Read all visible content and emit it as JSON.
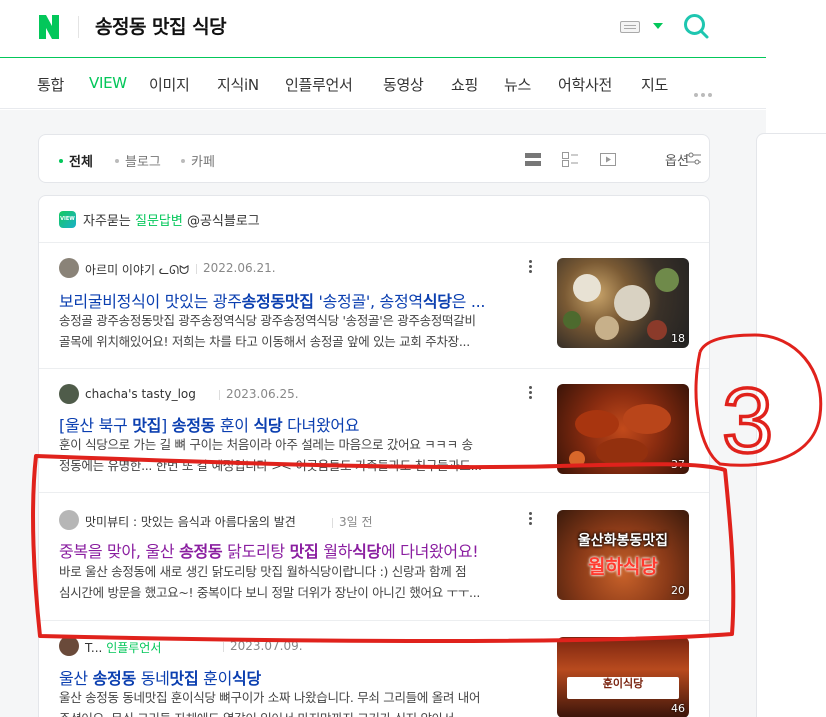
{
  "header": {
    "logo": "N",
    "query": "송정동 맛집 식당",
    "colors": {
      "brand": "#03c75a"
    }
  },
  "tabs": [
    {
      "label": "통합",
      "active": false
    },
    {
      "label": "VIEW",
      "active": true
    },
    {
      "label": "이미지",
      "active": false
    },
    {
      "label": "지식iN",
      "active": false
    },
    {
      "label": "인플루언서",
      "active": false
    },
    {
      "label": "동영상",
      "active": false
    },
    {
      "label": "쇼핑",
      "active": false
    },
    {
      "label": "뉴스",
      "active": false
    },
    {
      "label": "어학사전",
      "active": false
    },
    {
      "label": "지도",
      "active": false
    }
  ],
  "filters": {
    "items": [
      {
        "label": "전체",
        "active": true
      },
      {
        "label": "블로그",
        "active": false
      },
      {
        "label": "카페",
        "active": false
      }
    ],
    "options_label": "옵션"
  },
  "faq": {
    "badge": "VIEW",
    "prefix": "자주묻는",
    "highlight": "질문답변",
    "suffix": "@공식블로그"
  },
  "results": [
    {
      "author": "아르미 이야기",
      "author_emoji": "ᓚᘏᗢ",
      "date": "2022.06.21.",
      "title_parts": [
        "보리굴비정식이 맛있는 광주",
        "송정동맛집",
        " '송정골', 송정역",
        "식당",
        "은 ..."
      ],
      "desc_line1": "송정골 광주송정동맛집 광주송정역식당 광주송정역식당 '송정골'은 광주송정떡갈비",
      "desc_line2": "골목에 위치해있어요! 저희는 차를 타고 이동해서 송정골 앞에 있는 교회 주차장...",
      "thumb_count": "18"
    },
    {
      "author": "chacha's tasty_log",
      "date": "2023.06.25.",
      "title_parts": [
        "[울산 북구 ",
        "맛집",
        "] ",
        "송정동",
        " 훈이 ",
        "식당",
        " 다녀왔어요"
      ],
      "desc_line1": "훈이 식당으로 가는 길 뼈 구이는 처음이라 아주 설레는 마음으로 갔어요 ㅋㅋㅋ 송",
      "desc_line2": "정동에는 유명한... 한번 또 갈 예정입니다 >< 이곳음들도 가족들과도 친구들과도...",
      "thumb_count": "37"
    },
    {
      "author": "맛미뷰티 : 맛있는 음식과 아름다움의 발견",
      "date": "3일 전",
      "title_parts": [
        "중복을 맞아, 울산 ",
        "송정동",
        " 닭도리탕 ",
        "맛집",
        " 월하",
        "식당",
        "에 다녀왔어요!"
      ],
      "desc_line1": "바로 울산 송정동에 새로 생긴 닭도리탕 맛집 월하식당이랍니다 :) 신랑과 함께 점",
      "desc_line2": "심시간에 방문을 했고요~! 중복이다 보니 정말 더위가 장난이 아니긴 했어요 ㅜㅜ...",
      "thumb_line1": "울산화봉동맛집",
      "thumb_line2": "월하식당",
      "thumb_count": "20"
    },
    {
      "author": "T...",
      "author_role": "인플루언서",
      "date": "2023.07.09.",
      "title_parts": [
        "울산 ",
        "송정동",
        " 동네",
        "맛집",
        " 훈이",
        "식당"
      ],
      "desc_line1": "울산 송정동 동네맛집 훈이식당 뼈구이가 소짜 나왔습니다. 무쇠 그리들에 올려 내어",
      "desc_line2": "주셨어요. 무쇠 그리들 자체에도 열감이 있어서 마지막까지 고기가 식지 않아서...",
      "thumb_line1": "훈이식당",
      "thumb_count": "46"
    }
  ],
  "annotation": {
    "label": "3",
    "color": "#e0221c"
  }
}
